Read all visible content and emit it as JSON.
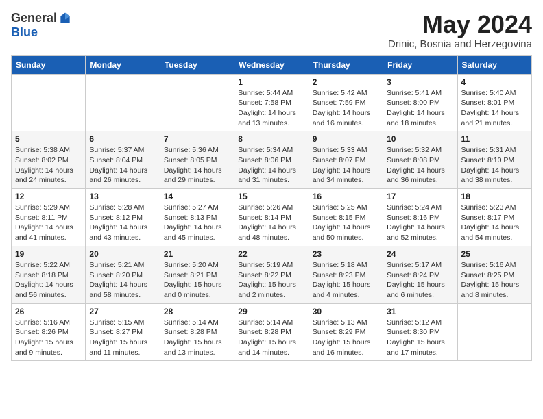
{
  "header": {
    "logo_general": "General",
    "logo_blue": "Blue",
    "month_title": "May 2024",
    "location": "Drinic, Bosnia and Herzegovina"
  },
  "days_of_week": [
    "Sunday",
    "Monday",
    "Tuesday",
    "Wednesday",
    "Thursday",
    "Friday",
    "Saturday"
  ],
  "weeks": [
    [
      {
        "day": "",
        "info": ""
      },
      {
        "day": "",
        "info": ""
      },
      {
        "day": "",
        "info": ""
      },
      {
        "day": "1",
        "info": "Sunrise: 5:44 AM\nSunset: 7:58 PM\nDaylight: 14 hours and 13 minutes."
      },
      {
        "day": "2",
        "info": "Sunrise: 5:42 AM\nSunset: 7:59 PM\nDaylight: 14 hours and 16 minutes."
      },
      {
        "day": "3",
        "info": "Sunrise: 5:41 AM\nSunset: 8:00 PM\nDaylight: 14 hours and 18 minutes."
      },
      {
        "day": "4",
        "info": "Sunrise: 5:40 AM\nSunset: 8:01 PM\nDaylight: 14 hours and 21 minutes."
      }
    ],
    [
      {
        "day": "5",
        "info": "Sunrise: 5:38 AM\nSunset: 8:02 PM\nDaylight: 14 hours and 24 minutes."
      },
      {
        "day": "6",
        "info": "Sunrise: 5:37 AM\nSunset: 8:04 PM\nDaylight: 14 hours and 26 minutes."
      },
      {
        "day": "7",
        "info": "Sunrise: 5:36 AM\nSunset: 8:05 PM\nDaylight: 14 hours and 29 minutes."
      },
      {
        "day": "8",
        "info": "Sunrise: 5:34 AM\nSunset: 8:06 PM\nDaylight: 14 hours and 31 minutes."
      },
      {
        "day": "9",
        "info": "Sunrise: 5:33 AM\nSunset: 8:07 PM\nDaylight: 14 hours and 34 minutes."
      },
      {
        "day": "10",
        "info": "Sunrise: 5:32 AM\nSunset: 8:08 PM\nDaylight: 14 hours and 36 minutes."
      },
      {
        "day": "11",
        "info": "Sunrise: 5:31 AM\nSunset: 8:10 PM\nDaylight: 14 hours and 38 minutes."
      }
    ],
    [
      {
        "day": "12",
        "info": "Sunrise: 5:29 AM\nSunset: 8:11 PM\nDaylight: 14 hours and 41 minutes."
      },
      {
        "day": "13",
        "info": "Sunrise: 5:28 AM\nSunset: 8:12 PM\nDaylight: 14 hours and 43 minutes."
      },
      {
        "day": "14",
        "info": "Sunrise: 5:27 AM\nSunset: 8:13 PM\nDaylight: 14 hours and 45 minutes."
      },
      {
        "day": "15",
        "info": "Sunrise: 5:26 AM\nSunset: 8:14 PM\nDaylight: 14 hours and 48 minutes."
      },
      {
        "day": "16",
        "info": "Sunrise: 5:25 AM\nSunset: 8:15 PM\nDaylight: 14 hours and 50 minutes."
      },
      {
        "day": "17",
        "info": "Sunrise: 5:24 AM\nSunset: 8:16 PM\nDaylight: 14 hours and 52 minutes."
      },
      {
        "day": "18",
        "info": "Sunrise: 5:23 AM\nSunset: 8:17 PM\nDaylight: 14 hours and 54 minutes."
      }
    ],
    [
      {
        "day": "19",
        "info": "Sunrise: 5:22 AM\nSunset: 8:18 PM\nDaylight: 14 hours and 56 minutes."
      },
      {
        "day": "20",
        "info": "Sunrise: 5:21 AM\nSunset: 8:20 PM\nDaylight: 14 hours and 58 minutes."
      },
      {
        "day": "21",
        "info": "Sunrise: 5:20 AM\nSunset: 8:21 PM\nDaylight: 15 hours and 0 minutes."
      },
      {
        "day": "22",
        "info": "Sunrise: 5:19 AM\nSunset: 8:22 PM\nDaylight: 15 hours and 2 minutes."
      },
      {
        "day": "23",
        "info": "Sunrise: 5:18 AM\nSunset: 8:23 PM\nDaylight: 15 hours and 4 minutes."
      },
      {
        "day": "24",
        "info": "Sunrise: 5:17 AM\nSunset: 8:24 PM\nDaylight: 15 hours and 6 minutes."
      },
      {
        "day": "25",
        "info": "Sunrise: 5:16 AM\nSunset: 8:25 PM\nDaylight: 15 hours and 8 minutes."
      }
    ],
    [
      {
        "day": "26",
        "info": "Sunrise: 5:16 AM\nSunset: 8:26 PM\nDaylight: 15 hours and 9 minutes."
      },
      {
        "day": "27",
        "info": "Sunrise: 5:15 AM\nSunset: 8:27 PM\nDaylight: 15 hours and 11 minutes."
      },
      {
        "day": "28",
        "info": "Sunrise: 5:14 AM\nSunset: 8:28 PM\nDaylight: 15 hours and 13 minutes."
      },
      {
        "day": "29",
        "info": "Sunrise: 5:14 AM\nSunset: 8:28 PM\nDaylight: 15 hours and 14 minutes."
      },
      {
        "day": "30",
        "info": "Sunrise: 5:13 AM\nSunset: 8:29 PM\nDaylight: 15 hours and 16 minutes."
      },
      {
        "day": "31",
        "info": "Sunrise: 5:12 AM\nSunset: 8:30 PM\nDaylight: 15 hours and 17 minutes."
      },
      {
        "day": "",
        "info": ""
      }
    ]
  ]
}
